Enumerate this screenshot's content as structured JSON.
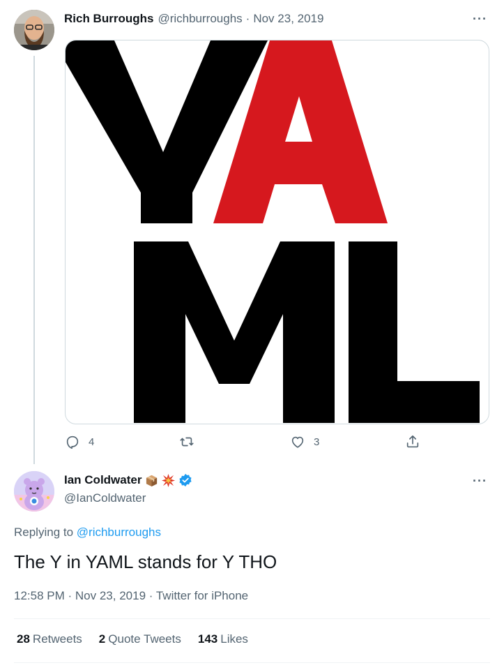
{
  "tweet1": {
    "name": "Rich Burroughs",
    "handle": "@richburroughs",
    "separator": "·",
    "date": "Nov 23, 2019",
    "more_label": "···",
    "image_text": {
      "y": "Y",
      "a": "A",
      "m": "M",
      "l": "L"
    },
    "replies": "4",
    "retweets": "",
    "likes": "3",
    "colors": {
      "black": "#000000",
      "red": "#d6181e"
    }
  },
  "tweet2": {
    "name": "Ian Coldwater",
    "handle": "@IanColdwater",
    "badges": [
      "package-emoji-icon",
      "explosion-emoji-icon",
      "verified-icon"
    ],
    "more_label": "···",
    "replying_prefix": "Replying to",
    "replying_to": "@richburroughs",
    "text": "The Y in YAML stands for Y THO",
    "time": "12:58 PM",
    "date": "Nov 23, 2019",
    "source": "Twitter for iPhone",
    "separator": "·",
    "stats": {
      "retweets_count": "28",
      "retweets_label": "Retweets",
      "quotes_count": "2",
      "quotes_label": "Quote Tweets",
      "likes_count": "143",
      "likes_label": "Likes"
    }
  },
  "colors": {
    "link": "#1d9bf0",
    "muted": "#536471",
    "verified": "#1d9bf0"
  }
}
